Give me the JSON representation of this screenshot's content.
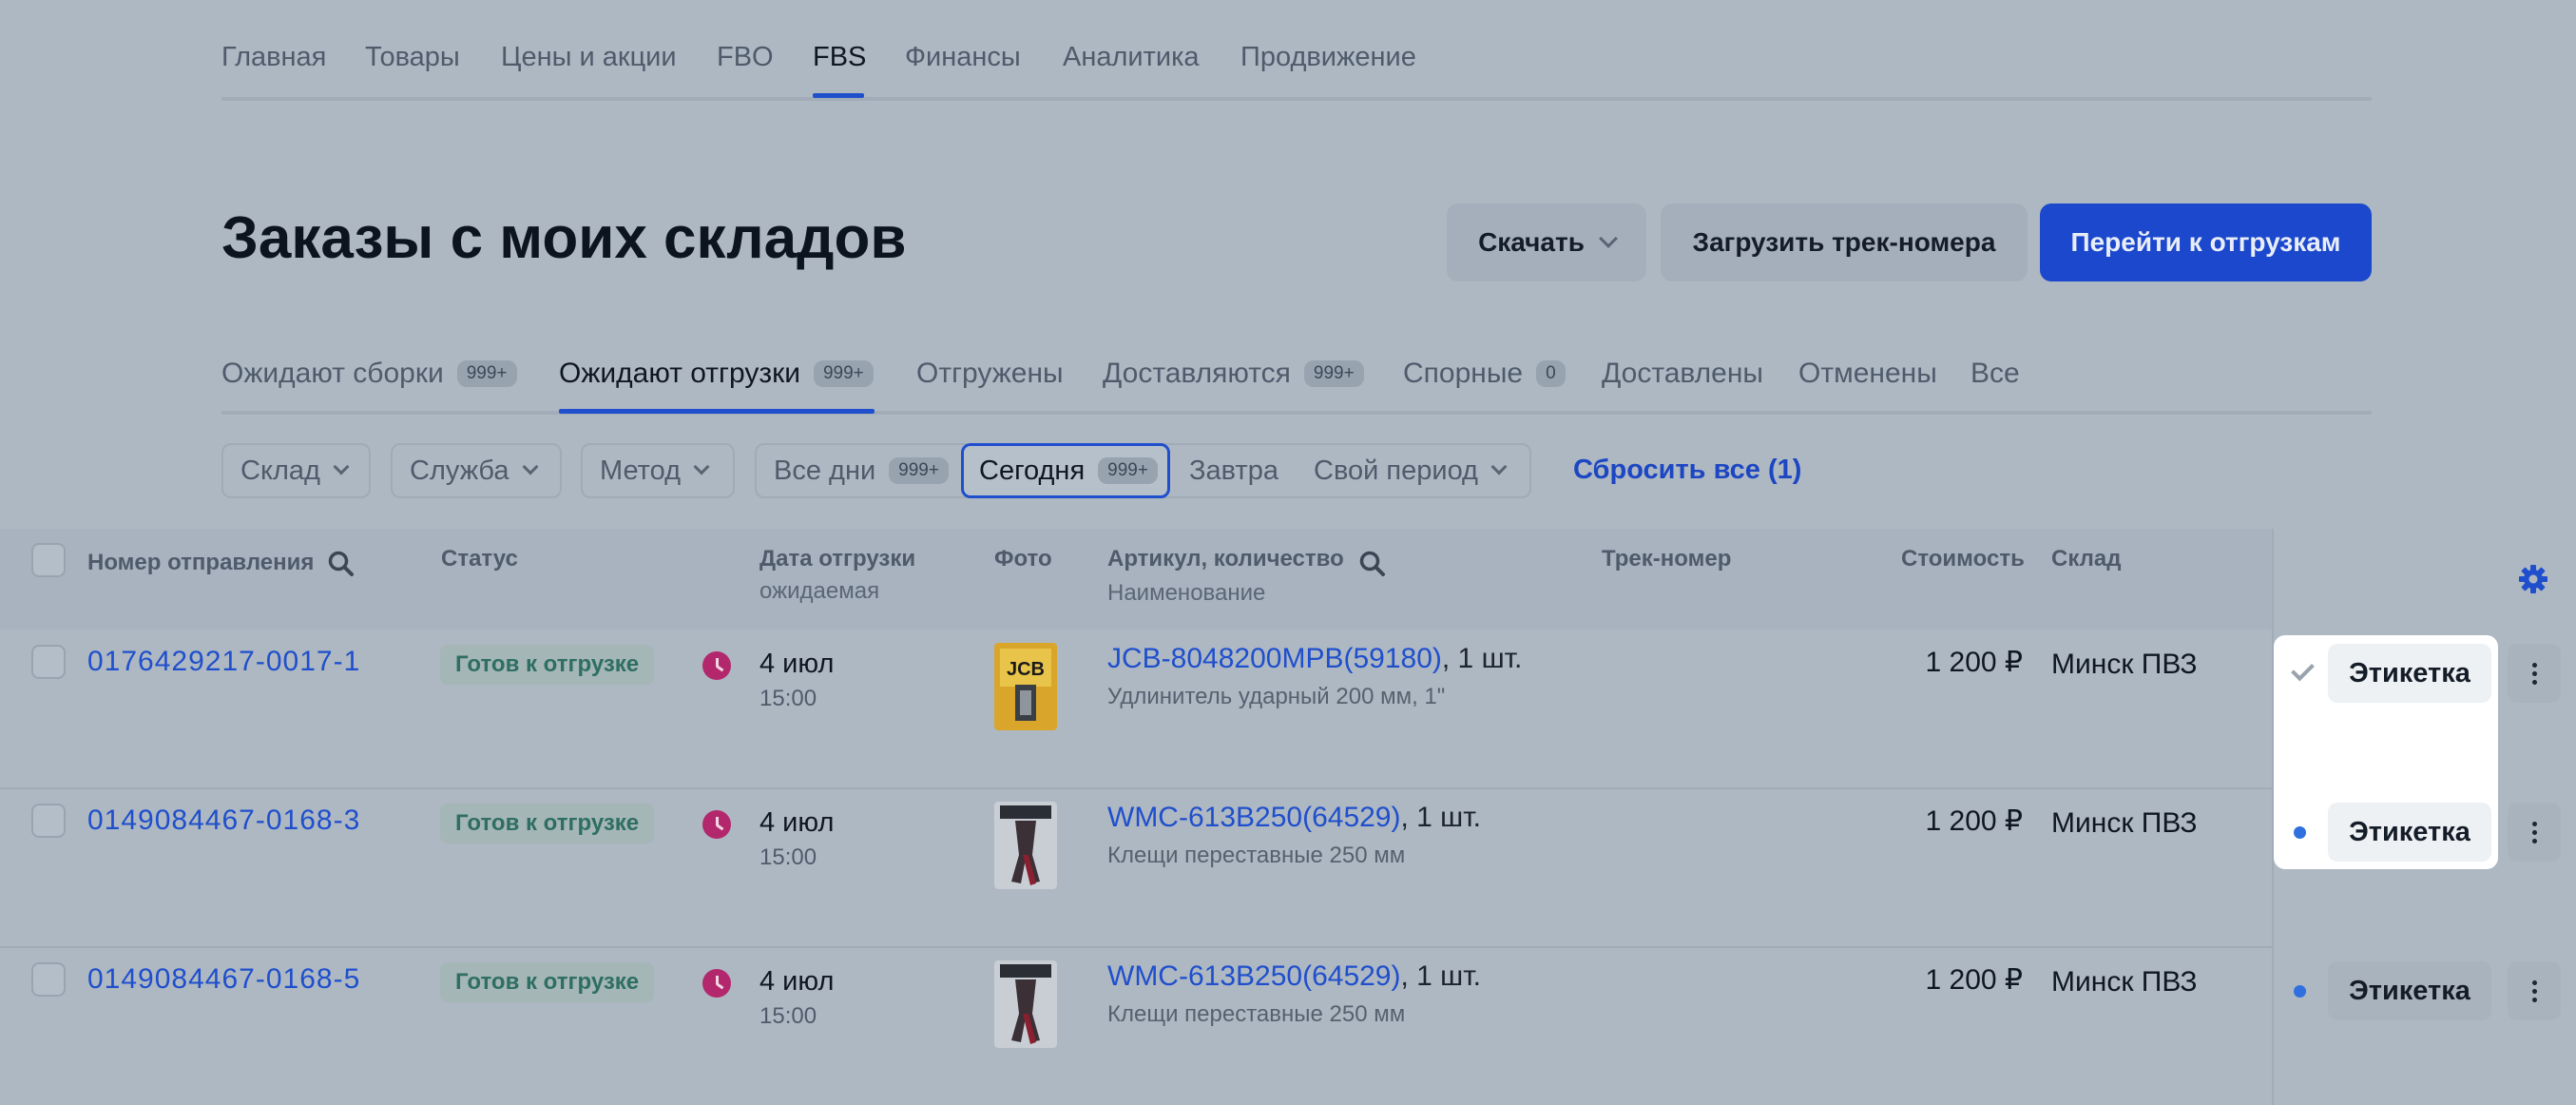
{
  "nav": {
    "items": [
      "Главная",
      "Товары",
      "Цены и акции",
      "FBO",
      "FBS",
      "Финансы",
      "Аналитика",
      "Продвижение"
    ],
    "active": "FBS"
  },
  "header": {
    "title": "Заказы с моих складов",
    "download_label": "Скачать",
    "upload_tracks_label": "Загрузить трек-номера",
    "go_to_shipments_label": "Перейти к отгрузкам"
  },
  "tabs": [
    {
      "label": "Ожидают сборки",
      "badge": "999+"
    },
    {
      "label": "Ожидают отгрузки",
      "badge": "999+"
    },
    {
      "label": "Отгружены",
      "badge": ""
    },
    {
      "label": "Доставляются",
      "badge": "999+"
    },
    {
      "label": "Спорные",
      "badge": "0"
    },
    {
      "label": "Доставлены",
      "badge": ""
    },
    {
      "label": "Отменены",
      "badge": ""
    },
    {
      "label": "Все",
      "badge": ""
    }
  ],
  "active_tab": "Ожидают отгрузки",
  "filters": {
    "warehouse": "Склад",
    "service": "Служба",
    "method": "Метод",
    "all_days": "Все дни",
    "all_days_badge": "999+",
    "today": "Сегодня",
    "today_badge": "999+",
    "tomorrow": "Завтра",
    "custom_period": "Свой период",
    "reset": "Сбросить все (1)"
  },
  "table": {
    "columns": {
      "order_number": "Номер отправления",
      "status": "Статус",
      "ship_date": "Дата отгрузки",
      "ship_date_sub": "ожидаемая",
      "photo": "Фото",
      "sku": "Артикул, количество",
      "sku_sub": "Наименование",
      "track": "Трек-номер",
      "cost": "Стоимость",
      "warehouse": "Склад"
    },
    "rows": [
      {
        "order": "0176429217-0017-1",
        "status": "Готов к отгрузке",
        "date": "4 июл",
        "time": "15:00",
        "sku": "JCB-8048200MPB(59180)",
        "qty": ", 1 шт.",
        "name": "Удлинитель ударный 200 мм, 1\"",
        "price": "1 200 ₽",
        "warehouse": "Минск ПВЗ",
        "label_btn": "Этикетка",
        "label_state": "printed"
      },
      {
        "order": "0149084467-0168-3",
        "status": "Готов к отгрузке",
        "date": "4 июл",
        "time": "15:00",
        "sku": "WMC-613B250(64529)",
        "qty": ", 1 шт.",
        "name": "Клещи переставные 250 мм",
        "price": "1 200 ₽",
        "warehouse": "Минск ПВЗ",
        "label_btn": "Этикетка",
        "label_state": "new"
      },
      {
        "order": "0149084467-0168-5",
        "status": "Готов к отгрузке",
        "date": "4 июл",
        "time": "15:00",
        "sku": "WMC-613B250(64529)",
        "qty": ", 1 шт.",
        "name": "Клещи переставные 250 мм",
        "price": "1 200 ₽",
        "warehouse": "Минск ПВЗ",
        "label_btn": "Этикетка",
        "label_state": "new"
      }
    ]
  },
  "colors": {
    "accent": "#1f4fcc",
    "background_dim": "#aeb8c3",
    "status_text": "#2f6e62",
    "clock": "#b3276d",
    "new_dot": "#2f6fe0"
  }
}
